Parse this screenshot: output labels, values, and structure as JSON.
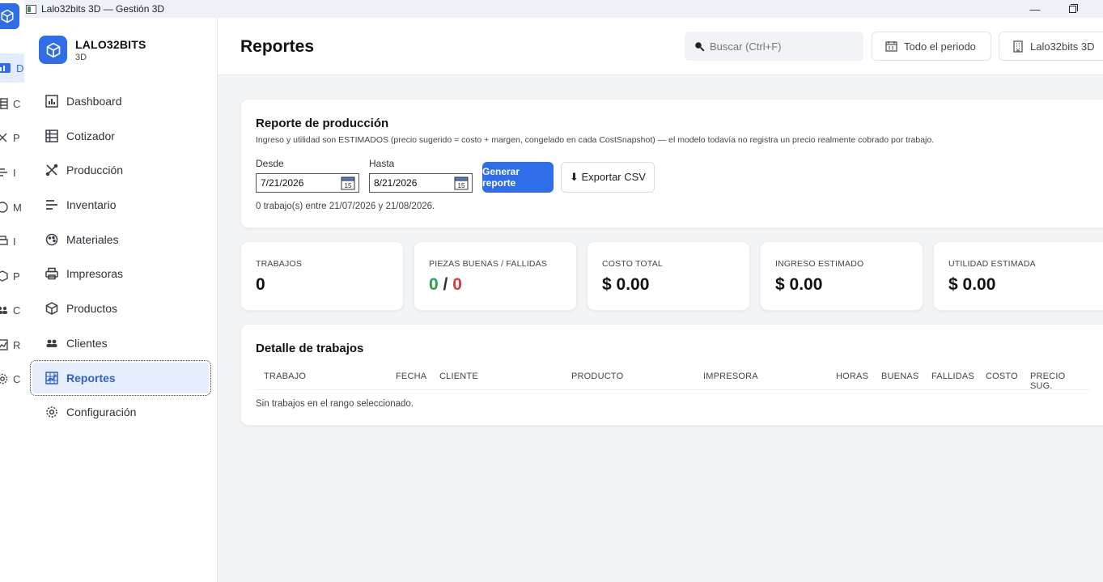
{
  "window": {
    "title": "Lalo32bits 3D — Gestión 3D",
    "minimize": "—"
  },
  "rail": {
    "items": [
      {
        "letter": "D",
        "active": true
      },
      {
        "letter": "C"
      },
      {
        "letter": "P"
      },
      {
        "letter": "I"
      },
      {
        "letter": "M"
      },
      {
        "letter": "I"
      },
      {
        "letter": "P"
      },
      {
        "letter": "C"
      },
      {
        "letter": "R"
      },
      {
        "letter": "C"
      }
    ]
  },
  "brand": {
    "name": "LALO32BITS",
    "sub": "3D"
  },
  "sidebar": {
    "items": [
      {
        "label": "Dashboard",
        "icon": "bar-chart-icon"
      },
      {
        "label": "Cotizador",
        "icon": "table-icon"
      },
      {
        "label": "Producción",
        "icon": "tools-icon"
      },
      {
        "label": "Inventario",
        "icon": "inventory-icon"
      },
      {
        "label": "Materiales",
        "icon": "palette-icon"
      },
      {
        "label": "Impresoras",
        "icon": "printer-icon"
      },
      {
        "label": "Productos",
        "icon": "box-icon"
      },
      {
        "label": "Clientes",
        "icon": "users-icon"
      },
      {
        "label": "Reportes",
        "icon": "report-icon",
        "active": true
      },
      {
        "label": "Configuración",
        "icon": "gear-icon"
      }
    ]
  },
  "header": {
    "title": "Reportes",
    "search_placeholder": "Buscar (Ctrl+F)",
    "period_label": "Todo el periodo",
    "org_label": "Lalo32bits 3D"
  },
  "report": {
    "title": "Reporte de producción",
    "description": "Ingreso y utilidad son ESTIMADOS (precio sugerido = costo + margen, congelado en cada CostSnapshot) — el modelo todavía no registra un precio realmente cobrado por trabajo.",
    "from_label": "Desde",
    "from_value": "7/21/2026",
    "to_label": "Hasta",
    "to_value": "8/21/2026",
    "generate_label": "Generar reporte",
    "export_label": "⬇ Exportar CSV",
    "summary": "0 trabajo(s) entre 21/07/2026 y 21/08/2026."
  },
  "kpis": {
    "jobs": {
      "label": "TRABAJOS",
      "value": "0"
    },
    "pieces": {
      "label": "PIEZAS BUENAS / FALLIDAS",
      "good": "0",
      "sep": " / ",
      "failed": "0"
    },
    "cost": {
      "label": "COSTO TOTAL",
      "value": "$ 0.00"
    },
    "revenue": {
      "label": "INGRESO ESTIMADO",
      "value": "$ 0.00"
    },
    "profit": {
      "label": "UTILIDAD ESTIMADA",
      "value": "$ 0.00"
    }
  },
  "detail": {
    "title": "Detalle de trabajos",
    "columns": [
      "TRABAJO",
      "FECHA",
      "CLIENTE",
      "PRODUCTO",
      "IMPRESORA",
      "HORAS",
      "BUENAS",
      "FALLIDAS",
      "COSTO",
      "PRECIO SUG."
    ],
    "empty_text": "Sin trabajos en el rango seleccionado."
  },
  "colors": {
    "accent": "#2f6ee8",
    "good": "#27a14e",
    "bad": "#d9393a"
  }
}
